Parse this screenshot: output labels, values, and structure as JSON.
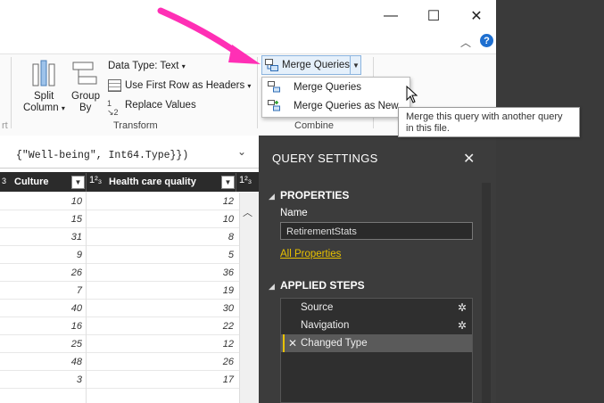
{
  "window": {
    "controls": {
      "minimize": "—",
      "maximize": "☐",
      "close": "✕"
    },
    "help": "?"
  },
  "ribbon": {
    "split_column": {
      "line1": "Split",
      "line2": "Column"
    },
    "group_by": {
      "line1": "Group",
      "line2": "By"
    },
    "data_type": "Data Type: Text",
    "first_row_headers": "Use First Row as Headers",
    "replace_values": "Replace Values",
    "transform_label": "Transform",
    "left_partial_label": "rt",
    "merge_queries": "Merge Queries",
    "combine_label": "Combine"
  },
  "dropdown": {
    "items": [
      "Merge Queries",
      "Merge Queries as New"
    ]
  },
  "tooltip": "Merge this query with another query in this file.",
  "formula": {
    "text": "{\"Well-being\", Int64.Type}})"
  },
  "grid": {
    "columns": [
      {
        "type": "1²₃",
        "name": "Culture"
      },
      {
        "type": "1²₃",
        "name": "Health care quality"
      },
      {
        "type": "1²₃",
        "name": ""
      }
    ],
    "rows": [
      [
        "10",
        "12"
      ],
      [
        "15",
        "10"
      ],
      [
        "31",
        "8"
      ],
      [
        "9",
        "5"
      ],
      [
        "26",
        "36"
      ],
      [
        "7",
        "19"
      ],
      [
        "40",
        "30"
      ],
      [
        "16",
        "22"
      ],
      [
        "25",
        "12"
      ],
      [
        "48",
        "26"
      ],
      [
        "3",
        "17"
      ]
    ]
  },
  "query_settings": {
    "title": "QUERY SETTINGS",
    "properties_header": "PROPERTIES",
    "name_label": "Name",
    "name_value": "RetirementStats",
    "all_properties": "All Properties",
    "applied_steps_header": "APPLIED STEPS",
    "steps": [
      "Source",
      "Navigation",
      "Changed Type"
    ]
  },
  "colors": {
    "accent_pink": "#ff2fb5",
    "link_yellow": "#e8c100",
    "panel_dark": "#3c3c3c",
    "help_blue": "#1e6fd0"
  }
}
